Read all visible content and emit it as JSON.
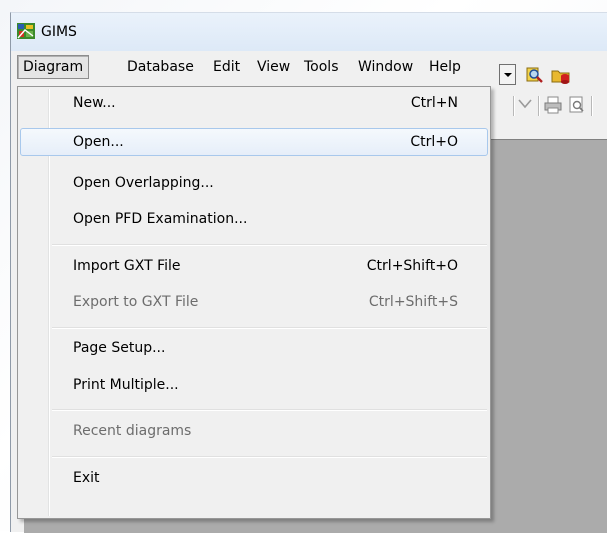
{
  "window": {
    "title": "GIMS",
    "icon": "gims-app-icon"
  },
  "menubar": {
    "items": [
      {
        "label": "Diagram",
        "active": true
      },
      {
        "label": "Database"
      },
      {
        "label": "Edit"
      },
      {
        "label": "View"
      },
      {
        "label": "Tools"
      },
      {
        "label": "Window"
      },
      {
        "label": "Help"
      }
    ]
  },
  "diagram_menu": {
    "items": [
      {
        "label": "New...",
        "shortcut": "Ctrl+N",
        "enabled": true
      },
      {
        "label": "Open...",
        "shortcut": "Ctrl+O",
        "enabled": true,
        "highlighted": true
      },
      {
        "label": "Open Overlapping...",
        "shortcut": "",
        "enabled": true
      },
      {
        "label": "Open PFD Examination...",
        "shortcut": "",
        "enabled": true
      },
      {
        "label": "Import GXT File",
        "shortcut": "Ctrl+Shift+O",
        "enabled": true
      },
      {
        "label": "Export to GXT File",
        "shortcut": "Ctrl+Shift+S",
        "enabled": false
      },
      {
        "label": "Page Setup...",
        "shortcut": "",
        "enabled": true
      },
      {
        "label": "Print Multiple...",
        "shortcut": "",
        "enabled": true
      },
      {
        "label": "Recent diagrams",
        "shortcut": "",
        "enabled": false
      },
      {
        "label": "Exit",
        "shortcut": "",
        "enabled": true
      }
    ]
  },
  "toolbar": {
    "icons": [
      "print-icon",
      "print-preview-icon",
      "search-db-icon",
      "open-db-icon"
    ]
  },
  "colors": {
    "menu_bg": "#f0f0f0",
    "highlight_border": "#a8c8ec",
    "disabled_text": "#6d6d6d",
    "workspace": "#ababab"
  }
}
